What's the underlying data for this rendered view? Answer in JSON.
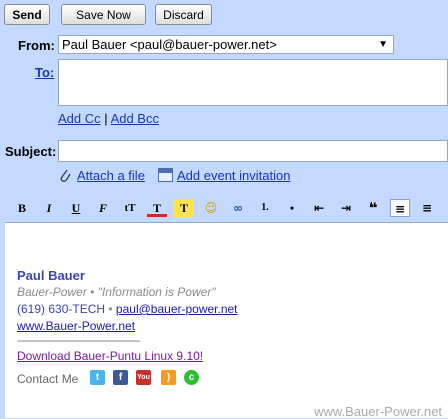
{
  "toolbar": {
    "send_label": "Send",
    "save_label": "Save Now",
    "discard_label": "Discard"
  },
  "from": {
    "label": "From:",
    "value": "Paul Bauer <paul@bauer-power.net>"
  },
  "to": {
    "label": "To:"
  },
  "cc": {
    "add_cc": "Add Cc",
    "separator": "|",
    "add_bcc": "Add Bcc"
  },
  "subject": {
    "label": "Subject:"
  },
  "attach": {
    "attach_label": "Attach a file",
    "event_label": "Add event invitation"
  },
  "format_bar": {
    "items": [
      "B",
      "I",
      "U",
      "F",
      "tT",
      "T",
      "T",
      "☺",
      "∞",
      "1.",
      "•",
      "⇤",
      "⇥",
      "❝",
      "≡",
      "≡"
    ]
  },
  "signature": {
    "name": "Paul Bauer",
    "tagline": "Bauer-Power • \"Information is Power\"",
    "phone": "(619) 630-TECH",
    "phone_sep": "•",
    "email": "paul@bauer-power.net",
    "website": "www.Bauer-Power.net",
    "rule": "----------------------------------------------",
    "download": "Download Bauer-Puntu Linux 9.10!",
    "contact": "Contact Me",
    "social_icons": [
      "twitter-icon",
      "facebook-icon",
      "youtube-icon",
      "rss-icon",
      "linkedin-icon"
    ]
  },
  "watermark": "www.Bauer-Power.net",
  "colors": {
    "background": "#c3d9ff",
    "link": "#1a35b8",
    "signature_name": "#3a45b5"
  }
}
